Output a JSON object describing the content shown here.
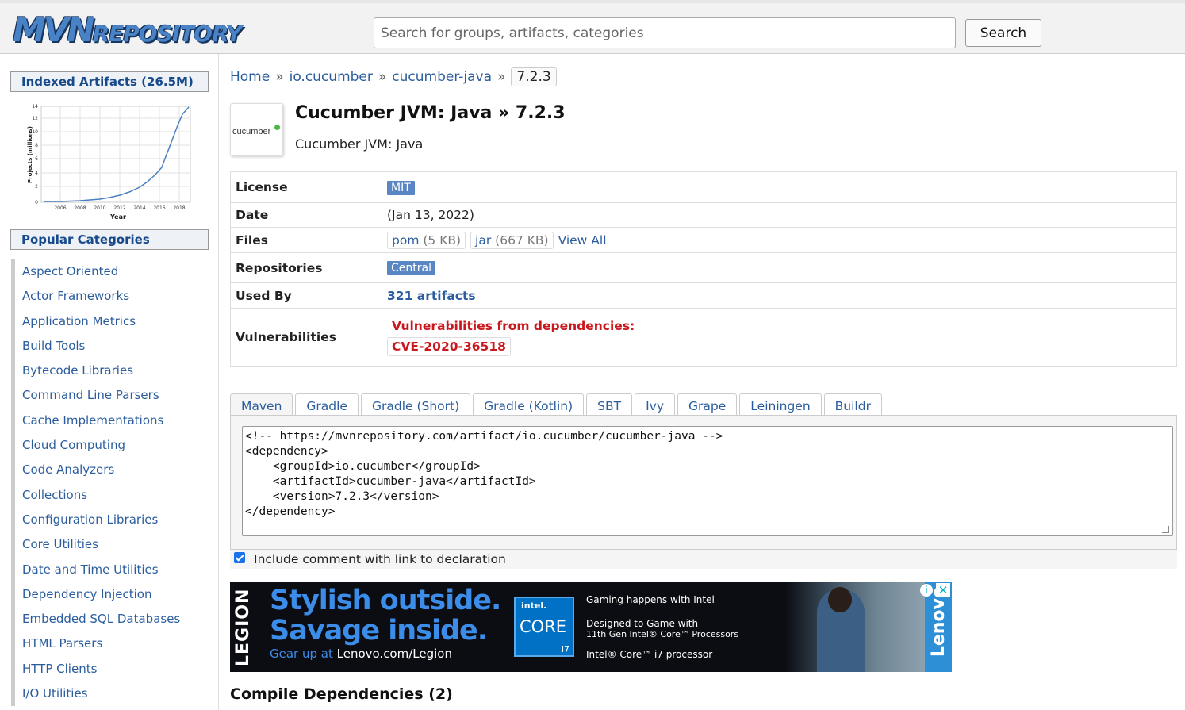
{
  "header": {
    "logo_big": "MVN",
    "logo_small": "REPOSITORY",
    "search_placeholder": "Search for groups, artifacts, categories",
    "search_button": "Search"
  },
  "sidebar": {
    "indexed_title": "Indexed Artifacts (26.5M)",
    "chart": {
      "ylabel": "Projects (millions)",
      "xlabel": "Year",
      "y_ticks": [
        "0",
        "2",
        "4",
        "6",
        "8",
        "10",
        "12",
        "14"
      ],
      "x_ticks": [
        "2006",
        "2008",
        "2010",
        "2012",
        "2014",
        "2016",
        "2018"
      ]
    },
    "popular_title": "Popular Categories",
    "categories": [
      "Aspect Oriented",
      "Actor Frameworks",
      "Application Metrics",
      "Build Tools",
      "Bytecode Libraries",
      "Command Line Parsers",
      "Cache Implementations",
      "Cloud Computing",
      "Code Analyzers",
      "Collections",
      "Configuration Libraries",
      "Core Utilities",
      "Date and Time Utilities",
      "Dependency Injection",
      "Embedded SQL Databases",
      "HTML Parsers",
      "HTTP Clients",
      "I/O Utilities"
    ]
  },
  "breadcrumb": {
    "home": "Home",
    "sep": "»",
    "group": "io.cucumber",
    "artifact": "cucumber-java",
    "version": "7.2.3"
  },
  "artifact": {
    "icon_text": "cucumber",
    "title": "Cucumber JVM: Java » 7.2.3",
    "subtitle": "Cucumber JVM: Java"
  },
  "info": {
    "license_label": "License",
    "license_value": "MIT",
    "date_label": "Date",
    "date_value": "(Jan 13, 2022)",
    "files_label": "Files",
    "files": [
      {
        "name": "pom",
        "size": "(5 KB)"
      },
      {
        "name": "jar",
        "size": "(667 KB)"
      }
    ],
    "view_all": "View All",
    "repos_label": "Repositories",
    "repos_value": "Central",
    "used_by_label": "Used By",
    "used_by_value": "321 artifacts",
    "vuln_label": "Vulnerabilities",
    "vuln_heading": "Vulnerabilities from dependencies:",
    "vuln_cve": "CVE-2020-36518"
  },
  "tabs": [
    "Maven",
    "Gradle",
    "Gradle (Short)",
    "Gradle (Kotlin)",
    "SBT",
    "Ivy",
    "Grape",
    "Leiningen",
    "Buildr"
  ],
  "active_tab": "Maven",
  "code_lines": [
    "<!-- https://mvnrepository.com/artifact/io.cucumber/cucumber-java -->",
    "<dependency>",
    "    <groupId>io.cucumber</groupId>",
    "    <artifactId>cucumber-java</artifactId>",
    "    <version>7.2.3</version>",
    "</dependency>"
  ],
  "include_comment_label": "Include comment with link to declaration",
  "include_comment_checked": true,
  "ad": {
    "brand_vertical": "LEGION",
    "line1": "Stylish outside.",
    "line2": "Savage inside.",
    "gear_prefix": "Gear up at ",
    "gear_url": "Lenovo.com/Legion",
    "intel_top": "intel.",
    "intel_core": "CORE",
    "intel_i7": "i7",
    "gaming": "Gaming happens with Intel",
    "designed1": "Designed to Game with",
    "designed2": "11th Gen Intel® Core™ Processors",
    "processor": "Intel® Core™ i7 processor",
    "lenovo": "Lenovo"
  },
  "compile_deps_heading": "Compile Dependencies (2)",
  "colors": {
    "link": "#2b5d9e",
    "badge": "#5b86c4",
    "danger": "#c9181d",
    "ad_blue": "#3b8de9"
  }
}
